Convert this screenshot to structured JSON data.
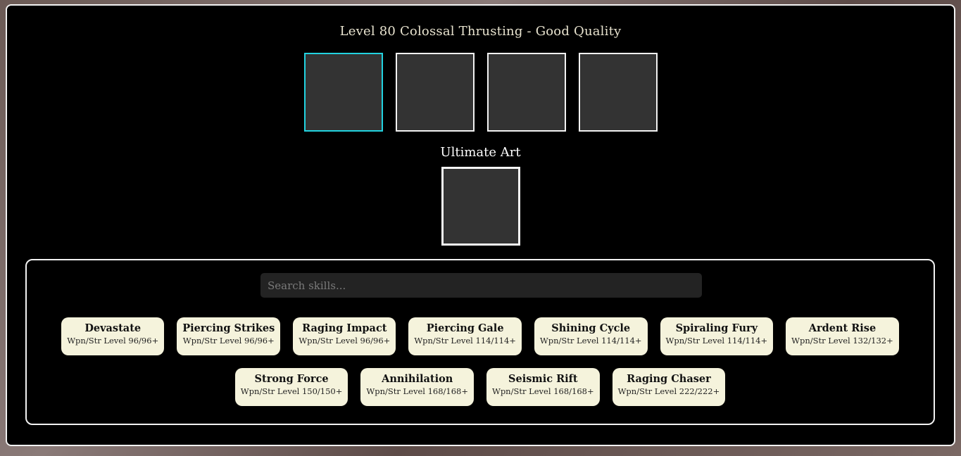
{
  "header": {
    "weapon_title": "Level 80 Colossal Thrusting - Good Quality"
  },
  "ultimate": {
    "label": "Ultimate Art"
  },
  "search": {
    "placeholder": "Search skills..."
  },
  "skills_row1": [
    {
      "name": "Devastate",
      "req": "Wpn/Str Level 96/96+"
    },
    {
      "name": "Piercing Strikes",
      "req": "Wpn/Str Level 96/96+"
    },
    {
      "name": "Raging Impact",
      "req": "Wpn/Str Level 96/96+"
    },
    {
      "name": "Piercing Gale",
      "req": "Wpn/Str Level 114/114+"
    },
    {
      "name": "Shining Cycle",
      "req": "Wpn/Str Level 114/114+"
    },
    {
      "name": "Spiraling Fury",
      "req": "Wpn/Str Level 114/114+"
    },
    {
      "name": "Ardent Rise",
      "req": "Wpn/Str Level 132/132+"
    }
  ],
  "skills_row2": [
    {
      "name": "Strong Force",
      "req": "Wpn/Str Level 150/150+"
    },
    {
      "name": "Annihilation",
      "req": "Wpn/Str Level 168/168+"
    },
    {
      "name": "Seismic Rift",
      "req": "Wpn/Str Level 168/168+"
    },
    {
      "name": "Raging Chaser",
      "req": "Wpn/Str Level 222/222+"
    }
  ],
  "colors": {
    "selected_slot_border": "#22d3e0",
    "slot_fill": "#333333",
    "skill_card_bg": "#f5f3dc"
  }
}
